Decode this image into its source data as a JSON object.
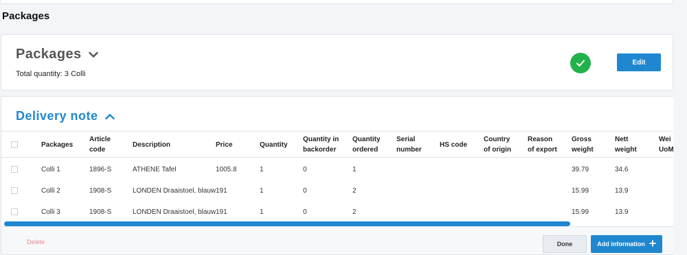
{
  "section": {
    "title": "Packages"
  },
  "packages_card": {
    "heading": "Packages",
    "total_label": "Total quantity: 3 Colli",
    "status_icon": "check-circle-icon",
    "edit_label": "Edit"
  },
  "delivery_card": {
    "heading": "Delivery note",
    "columns": [
      {
        "l1": "",
        "l2": "Packages"
      },
      {
        "l1": "Article",
        "l2": "code"
      },
      {
        "l1": "",
        "l2": "Description"
      },
      {
        "l1": "",
        "l2": "Price"
      },
      {
        "l1": "",
        "l2": "Quantity"
      },
      {
        "l1": "Quantity in",
        "l2": "backorder"
      },
      {
        "l1": "Quantity",
        "l2": "ordered"
      },
      {
        "l1": "Serial",
        "l2": "number"
      },
      {
        "l1": "",
        "l2": "HS code"
      },
      {
        "l1": "Country",
        "l2": "of origin"
      },
      {
        "l1": "Reason",
        "l2": "of export"
      },
      {
        "l1": "Gross",
        "l2": "weight"
      },
      {
        "l1": "Nett",
        "l2": "weight"
      },
      {
        "l1": "Wei",
        "l2": "UoM"
      }
    ],
    "rows": [
      [
        "Colli 1",
        "1896-S",
        "ATHENE Tafel",
        "1005.8",
        "1",
        "0",
        "1",
        "",
        "",
        "",
        "",
        "39.79",
        "34.6",
        ""
      ],
      [
        "Colli 2",
        "1908-S",
        "LONDEN Draaistoel, blauw",
        "191",
        "1",
        "0",
        "2",
        "",
        "",
        "",
        "",
        "15.99",
        "13.9",
        ""
      ],
      [
        "Colli 3",
        "1908-S",
        "LONDEN Draaistoel, blauw",
        "191",
        "1",
        "0",
        "2",
        "",
        "",
        "",
        "",
        "15.99",
        "13.9",
        ""
      ]
    ],
    "footer": {
      "delete_label": "Delete",
      "done_label": "Done",
      "add_label": "Add information"
    }
  },
  "colors": {
    "accent": "#1f87d0",
    "success": "#22b24c",
    "danger": "#e88b8b"
  }
}
